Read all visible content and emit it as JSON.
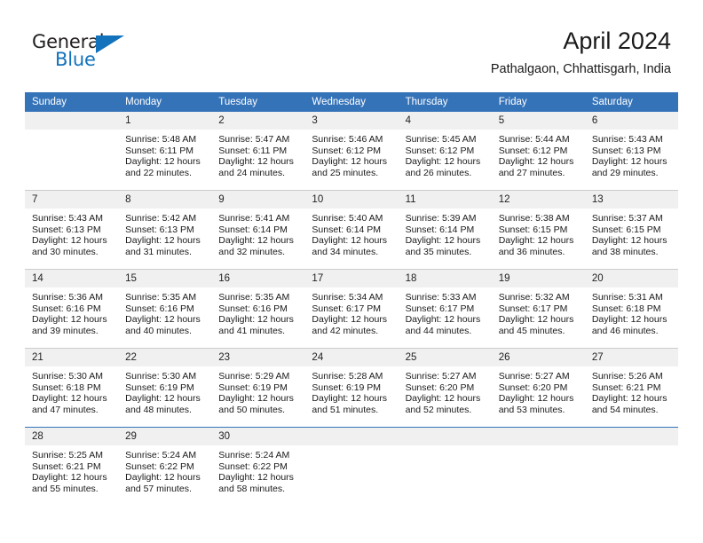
{
  "brand": {
    "name_part1": "General",
    "name_part2": "Blue",
    "accent_color": "#1272bb"
  },
  "header": {
    "title": "April 2024",
    "subtitle": "Pathalgaon, Chhattisgarh, India",
    "header_bg_color": "#3573b9"
  },
  "weekdays": [
    "Sunday",
    "Monday",
    "Tuesday",
    "Wednesday",
    "Thursday",
    "Friday",
    "Saturday"
  ],
  "weeks": [
    [
      {
        "day": "",
        "sunrise": "",
        "sunset": "",
        "daylight1": "",
        "daylight2": ""
      },
      {
        "day": "1",
        "sunrise": "Sunrise: 5:48 AM",
        "sunset": "Sunset: 6:11 PM",
        "daylight1": "Daylight: 12 hours",
        "daylight2": "and 22 minutes."
      },
      {
        "day": "2",
        "sunrise": "Sunrise: 5:47 AM",
        "sunset": "Sunset: 6:11 PM",
        "daylight1": "Daylight: 12 hours",
        "daylight2": "and 24 minutes."
      },
      {
        "day": "3",
        "sunrise": "Sunrise: 5:46 AM",
        "sunset": "Sunset: 6:12 PM",
        "daylight1": "Daylight: 12 hours",
        "daylight2": "and 25 minutes."
      },
      {
        "day": "4",
        "sunrise": "Sunrise: 5:45 AM",
        "sunset": "Sunset: 6:12 PM",
        "daylight1": "Daylight: 12 hours",
        "daylight2": "and 26 minutes."
      },
      {
        "day": "5",
        "sunrise": "Sunrise: 5:44 AM",
        "sunset": "Sunset: 6:12 PM",
        "daylight1": "Daylight: 12 hours",
        "daylight2": "and 27 minutes."
      },
      {
        "day": "6",
        "sunrise": "Sunrise: 5:43 AM",
        "sunset": "Sunset: 6:13 PM",
        "daylight1": "Daylight: 12 hours",
        "daylight2": "and 29 minutes."
      }
    ],
    [
      {
        "day": "7",
        "sunrise": "Sunrise: 5:43 AM",
        "sunset": "Sunset: 6:13 PM",
        "daylight1": "Daylight: 12 hours",
        "daylight2": "and 30 minutes."
      },
      {
        "day": "8",
        "sunrise": "Sunrise: 5:42 AM",
        "sunset": "Sunset: 6:13 PM",
        "daylight1": "Daylight: 12 hours",
        "daylight2": "and 31 minutes."
      },
      {
        "day": "9",
        "sunrise": "Sunrise: 5:41 AM",
        "sunset": "Sunset: 6:14 PM",
        "daylight1": "Daylight: 12 hours",
        "daylight2": "and 32 minutes."
      },
      {
        "day": "10",
        "sunrise": "Sunrise: 5:40 AM",
        "sunset": "Sunset: 6:14 PM",
        "daylight1": "Daylight: 12 hours",
        "daylight2": "and 34 minutes."
      },
      {
        "day": "11",
        "sunrise": "Sunrise: 5:39 AM",
        "sunset": "Sunset: 6:14 PM",
        "daylight1": "Daylight: 12 hours",
        "daylight2": "and 35 minutes."
      },
      {
        "day": "12",
        "sunrise": "Sunrise: 5:38 AM",
        "sunset": "Sunset: 6:15 PM",
        "daylight1": "Daylight: 12 hours",
        "daylight2": "and 36 minutes."
      },
      {
        "day": "13",
        "sunrise": "Sunrise: 5:37 AM",
        "sunset": "Sunset: 6:15 PM",
        "daylight1": "Daylight: 12 hours",
        "daylight2": "and 38 minutes."
      }
    ],
    [
      {
        "day": "14",
        "sunrise": "Sunrise: 5:36 AM",
        "sunset": "Sunset: 6:16 PM",
        "daylight1": "Daylight: 12 hours",
        "daylight2": "and 39 minutes."
      },
      {
        "day": "15",
        "sunrise": "Sunrise: 5:35 AM",
        "sunset": "Sunset: 6:16 PM",
        "daylight1": "Daylight: 12 hours",
        "daylight2": "and 40 minutes."
      },
      {
        "day": "16",
        "sunrise": "Sunrise: 5:35 AM",
        "sunset": "Sunset: 6:16 PM",
        "daylight1": "Daylight: 12 hours",
        "daylight2": "and 41 minutes."
      },
      {
        "day": "17",
        "sunrise": "Sunrise: 5:34 AM",
        "sunset": "Sunset: 6:17 PM",
        "daylight1": "Daylight: 12 hours",
        "daylight2": "and 42 minutes."
      },
      {
        "day": "18",
        "sunrise": "Sunrise: 5:33 AM",
        "sunset": "Sunset: 6:17 PM",
        "daylight1": "Daylight: 12 hours",
        "daylight2": "and 44 minutes."
      },
      {
        "day": "19",
        "sunrise": "Sunrise: 5:32 AM",
        "sunset": "Sunset: 6:17 PM",
        "daylight1": "Daylight: 12 hours",
        "daylight2": "and 45 minutes."
      },
      {
        "day": "20",
        "sunrise": "Sunrise: 5:31 AM",
        "sunset": "Sunset: 6:18 PM",
        "daylight1": "Daylight: 12 hours",
        "daylight2": "and 46 minutes."
      }
    ],
    [
      {
        "day": "21",
        "sunrise": "Sunrise: 5:30 AM",
        "sunset": "Sunset: 6:18 PM",
        "daylight1": "Daylight: 12 hours",
        "daylight2": "and 47 minutes."
      },
      {
        "day": "22",
        "sunrise": "Sunrise: 5:30 AM",
        "sunset": "Sunset: 6:19 PM",
        "daylight1": "Daylight: 12 hours",
        "daylight2": "and 48 minutes."
      },
      {
        "day": "23",
        "sunrise": "Sunrise: 5:29 AM",
        "sunset": "Sunset: 6:19 PM",
        "daylight1": "Daylight: 12 hours",
        "daylight2": "and 50 minutes."
      },
      {
        "day": "24",
        "sunrise": "Sunrise: 5:28 AM",
        "sunset": "Sunset: 6:19 PM",
        "daylight1": "Daylight: 12 hours",
        "daylight2": "and 51 minutes."
      },
      {
        "day": "25",
        "sunrise": "Sunrise: 5:27 AM",
        "sunset": "Sunset: 6:20 PM",
        "daylight1": "Daylight: 12 hours",
        "daylight2": "and 52 minutes."
      },
      {
        "day": "26",
        "sunrise": "Sunrise: 5:27 AM",
        "sunset": "Sunset: 6:20 PM",
        "daylight1": "Daylight: 12 hours",
        "daylight2": "and 53 minutes."
      },
      {
        "day": "27",
        "sunrise": "Sunrise: 5:26 AM",
        "sunset": "Sunset: 6:21 PM",
        "daylight1": "Daylight: 12 hours",
        "daylight2": "and 54 minutes."
      }
    ],
    [
      {
        "day": "28",
        "sunrise": "Sunrise: 5:25 AM",
        "sunset": "Sunset: 6:21 PM",
        "daylight1": "Daylight: 12 hours",
        "daylight2": "and 55 minutes."
      },
      {
        "day": "29",
        "sunrise": "Sunrise: 5:24 AM",
        "sunset": "Sunset: 6:22 PM",
        "daylight1": "Daylight: 12 hours",
        "daylight2": "and 57 minutes."
      },
      {
        "day": "30",
        "sunrise": "Sunrise: 5:24 AM",
        "sunset": "Sunset: 6:22 PM",
        "daylight1": "Daylight: 12 hours",
        "daylight2": "and 58 minutes."
      },
      {
        "day": "",
        "sunrise": "",
        "sunset": "",
        "daylight1": "",
        "daylight2": ""
      },
      {
        "day": "",
        "sunrise": "",
        "sunset": "",
        "daylight1": "",
        "daylight2": ""
      },
      {
        "day": "",
        "sunrise": "",
        "sunset": "",
        "daylight1": "",
        "daylight2": ""
      },
      {
        "day": "",
        "sunrise": "",
        "sunset": "",
        "daylight1": "",
        "daylight2": ""
      }
    ]
  ]
}
